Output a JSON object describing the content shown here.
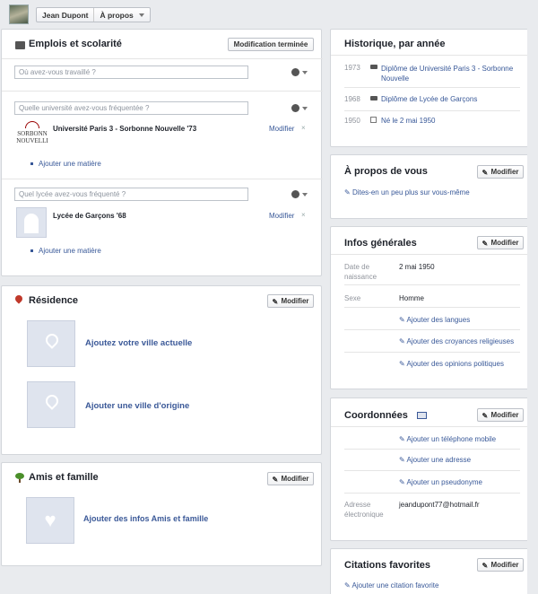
{
  "topbar": {
    "user_name": "Jean Dupont",
    "section": "À propos"
  },
  "work": {
    "title": "Emplois et scolarité",
    "done_button": "Modification terminée",
    "job_placeholder": "Où avez-vous travaillé ?",
    "university_placeholder": "Quelle université avez-vous fréquentée ?",
    "university_name": "Université Paris 3 - Sorbonne Nouvelle '73",
    "university_logo_text": [
      "SORBONN",
      "NOUVELLI"
    ],
    "modify": "Modifier",
    "add_subject": "Ajouter une matière",
    "highschool_placeholder": "Quel lycée avez-vous fréquenté ?",
    "highschool_name": "Lycée de Garçons '68"
  },
  "residence": {
    "title": "Résidence",
    "modify": "Modifier",
    "add_current": "Ajoutez votre ville actuelle",
    "add_origin": "Ajouter une ville d'origine"
  },
  "friends": {
    "title": "Amis et famille",
    "modify": "Modifier",
    "add": "Ajouter des infos Amis et famille"
  },
  "history": {
    "title": "Historique, par année",
    "items": [
      {
        "year": "1973",
        "text": "Diplôme de Université Paris 3 - Sorbonne Nouvelle"
      },
      {
        "year": "1968",
        "text": "Diplôme de Lycée de Garçons"
      },
      {
        "year": "1950",
        "text": "Né le 2 mai 1950"
      }
    ]
  },
  "about": {
    "title": "À propos de vous",
    "modify": "Modifier",
    "prompt": "Dites-en un peu plus sur vous-même"
  },
  "general": {
    "title": "Infos générales",
    "modify": "Modifier",
    "birth_label": "Date de naissance",
    "birth_value": "2 mai 1950",
    "sex_label": "Sexe",
    "sex_value": "Homme",
    "add_languages": "Ajouter des langues",
    "add_beliefs": "Ajouter des croyances religieuses",
    "add_politics": "Ajouter des opinions politiques"
  },
  "contact": {
    "title": "Coordonnées",
    "modify": "Modifier",
    "add_phone": "Ajouter un téléphone mobile",
    "add_address": "Ajouter une adresse",
    "add_nickname": "Ajouter un pseudonyme",
    "email_label": "Adresse électronique",
    "email_value": "jeandupont77@hotmail.fr"
  },
  "quotes": {
    "title": "Citations favorites",
    "modify": "Modifier",
    "add": "Ajouter une citation favorite"
  }
}
